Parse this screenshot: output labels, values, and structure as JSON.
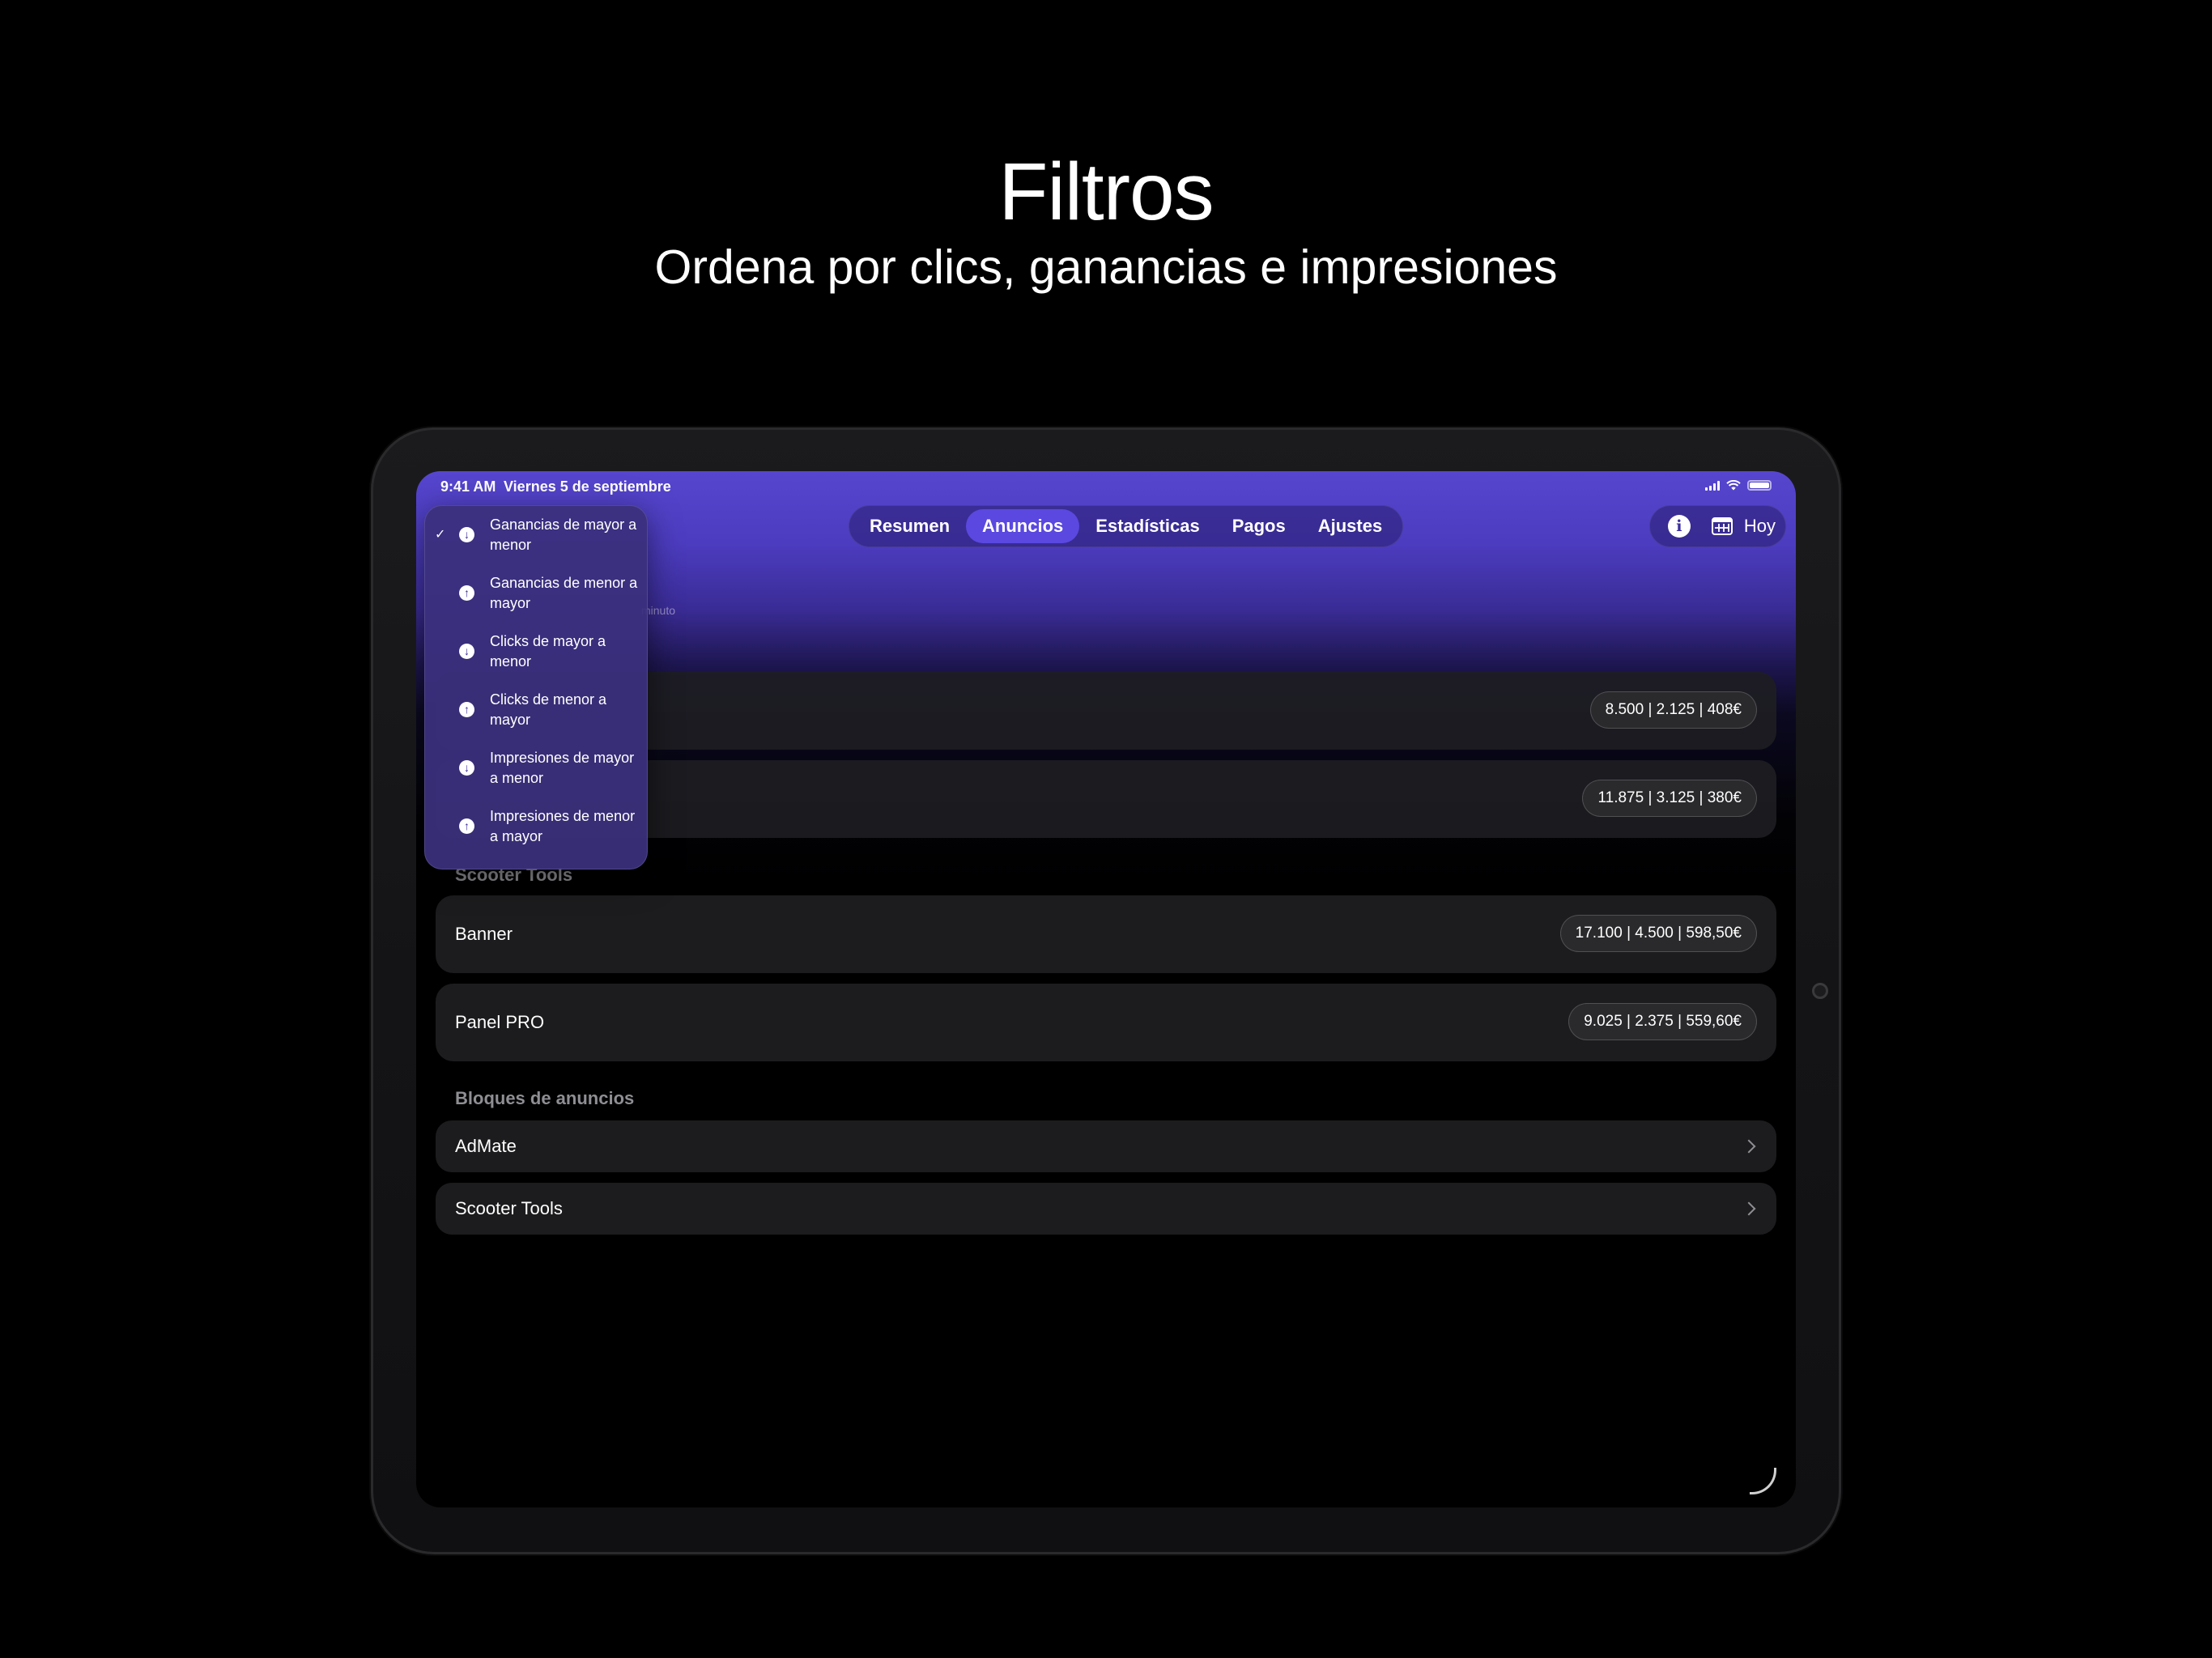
{
  "promo": {
    "title": "Filtros",
    "subtitle": "Ordena por clics, ganancias e impresiones"
  },
  "status_bar": {
    "time": "9:41 AM",
    "date": "Viernes 5 de septiembre",
    "icons": [
      "signal-icon",
      "wifi-icon",
      "battery-icon"
    ]
  },
  "tabs": [
    {
      "label": "Resumen",
      "active": false
    },
    {
      "label": "Anuncios",
      "active": true
    },
    {
      "label": "Estadísticas",
      "active": false
    },
    {
      "label": "Pagos",
      "active": false
    },
    {
      "label": "Ajustes",
      "active": false
    }
  ],
  "toolbar": {
    "info_icon": "info-icon",
    "calendar_icon": "calendar-icon",
    "today_label": "Hoy"
  },
  "hidden_caption": "minuto",
  "group_admate": {
    "cards": [
      {
        "label": "",
        "stats": "8.500 | 2.125 | 408€"
      },
      {
        "label": "",
        "stats": "11.875 | 3.125 | 380€"
      }
    ]
  },
  "group_scooter": {
    "title": "Scooter Tools",
    "cards": [
      {
        "label": "Banner",
        "stats": "17.100 | 4.500 | 598,50€"
      },
      {
        "label": "Panel PRO",
        "stats": "9.025 | 2.375 | 559,60€"
      }
    ]
  },
  "ad_blocks": {
    "title": "Bloques de anuncios",
    "items": [
      {
        "label": "AdMate"
      },
      {
        "label": "Scooter Tools"
      }
    ]
  },
  "sort_menu": {
    "items": [
      {
        "label": "Ganancias de mayor a menor",
        "checked": true,
        "direction": "down"
      },
      {
        "label": "Ganancias de menor a mayor",
        "checked": false,
        "direction": "up"
      },
      {
        "label": "Clicks de mayor a menor",
        "checked": false,
        "direction": "down"
      },
      {
        "label": "Clicks de menor a mayor",
        "checked": false,
        "direction": "up"
      },
      {
        "label": "Impresiones de mayor a menor",
        "checked": false,
        "direction": "down"
      },
      {
        "label": "Impresiones de menor a mayor",
        "checked": false,
        "direction": "up"
      }
    ]
  },
  "colors": {
    "accent": "#5a48e0",
    "header_gradient_top": "#5646cf",
    "card_bg": "#1c1c1e",
    "secondary_text": "#8e8e93"
  }
}
